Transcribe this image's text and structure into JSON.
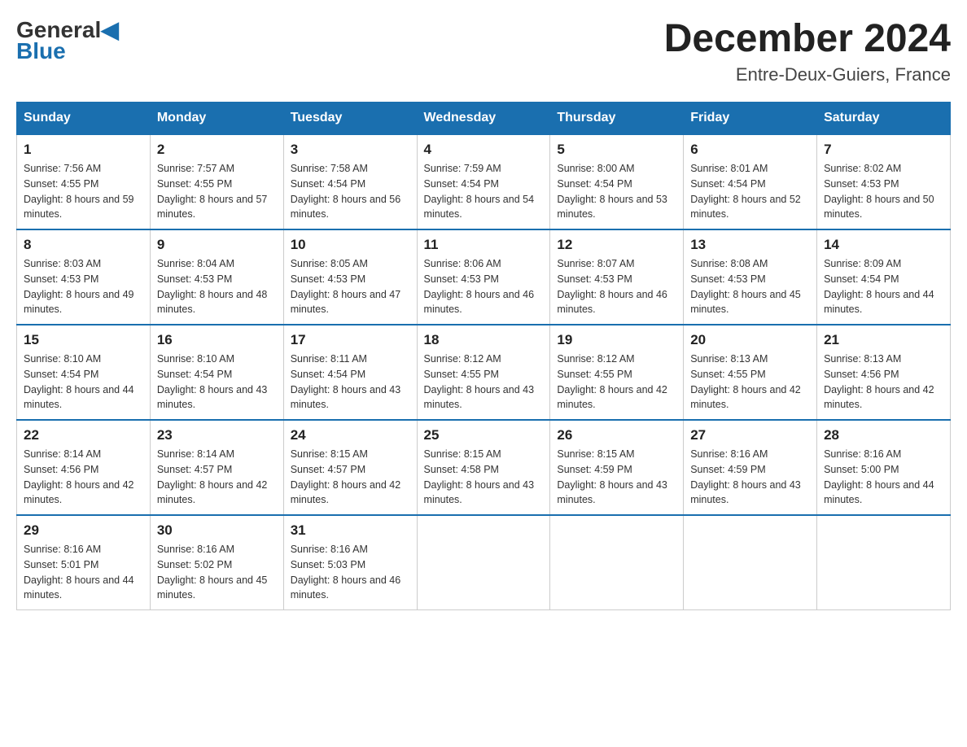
{
  "header": {
    "logo_general": "General",
    "logo_blue": "Blue",
    "month_year": "December 2024",
    "location": "Entre-Deux-Guiers, France"
  },
  "weekdays": [
    "Sunday",
    "Monday",
    "Tuesday",
    "Wednesday",
    "Thursday",
    "Friday",
    "Saturday"
  ],
  "weeks": [
    [
      {
        "day": "1",
        "sunrise": "7:56 AM",
        "sunset": "4:55 PM",
        "daylight": "8 hours and 59 minutes."
      },
      {
        "day": "2",
        "sunrise": "7:57 AM",
        "sunset": "4:55 PM",
        "daylight": "8 hours and 57 minutes."
      },
      {
        "day": "3",
        "sunrise": "7:58 AM",
        "sunset": "4:54 PM",
        "daylight": "8 hours and 56 minutes."
      },
      {
        "day": "4",
        "sunrise": "7:59 AM",
        "sunset": "4:54 PM",
        "daylight": "8 hours and 54 minutes."
      },
      {
        "day": "5",
        "sunrise": "8:00 AM",
        "sunset": "4:54 PM",
        "daylight": "8 hours and 53 minutes."
      },
      {
        "day": "6",
        "sunrise": "8:01 AM",
        "sunset": "4:54 PM",
        "daylight": "8 hours and 52 minutes."
      },
      {
        "day": "7",
        "sunrise": "8:02 AM",
        "sunset": "4:53 PM",
        "daylight": "8 hours and 50 minutes."
      }
    ],
    [
      {
        "day": "8",
        "sunrise": "8:03 AM",
        "sunset": "4:53 PM",
        "daylight": "8 hours and 49 minutes."
      },
      {
        "day": "9",
        "sunrise": "8:04 AM",
        "sunset": "4:53 PM",
        "daylight": "8 hours and 48 minutes."
      },
      {
        "day": "10",
        "sunrise": "8:05 AM",
        "sunset": "4:53 PM",
        "daylight": "8 hours and 47 minutes."
      },
      {
        "day": "11",
        "sunrise": "8:06 AM",
        "sunset": "4:53 PM",
        "daylight": "8 hours and 46 minutes."
      },
      {
        "day": "12",
        "sunrise": "8:07 AM",
        "sunset": "4:53 PM",
        "daylight": "8 hours and 46 minutes."
      },
      {
        "day": "13",
        "sunrise": "8:08 AM",
        "sunset": "4:53 PM",
        "daylight": "8 hours and 45 minutes."
      },
      {
        "day": "14",
        "sunrise": "8:09 AM",
        "sunset": "4:54 PM",
        "daylight": "8 hours and 44 minutes."
      }
    ],
    [
      {
        "day": "15",
        "sunrise": "8:10 AM",
        "sunset": "4:54 PM",
        "daylight": "8 hours and 44 minutes."
      },
      {
        "day": "16",
        "sunrise": "8:10 AM",
        "sunset": "4:54 PM",
        "daylight": "8 hours and 43 minutes."
      },
      {
        "day": "17",
        "sunrise": "8:11 AM",
        "sunset": "4:54 PM",
        "daylight": "8 hours and 43 minutes."
      },
      {
        "day": "18",
        "sunrise": "8:12 AM",
        "sunset": "4:55 PM",
        "daylight": "8 hours and 43 minutes."
      },
      {
        "day": "19",
        "sunrise": "8:12 AM",
        "sunset": "4:55 PM",
        "daylight": "8 hours and 42 minutes."
      },
      {
        "day": "20",
        "sunrise": "8:13 AM",
        "sunset": "4:55 PM",
        "daylight": "8 hours and 42 minutes."
      },
      {
        "day": "21",
        "sunrise": "8:13 AM",
        "sunset": "4:56 PM",
        "daylight": "8 hours and 42 minutes."
      }
    ],
    [
      {
        "day": "22",
        "sunrise": "8:14 AM",
        "sunset": "4:56 PM",
        "daylight": "8 hours and 42 minutes."
      },
      {
        "day": "23",
        "sunrise": "8:14 AM",
        "sunset": "4:57 PM",
        "daylight": "8 hours and 42 minutes."
      },
      {
        "day": "24",
        "sunrise": "8:15 AM",
        "sunset": "4:57 PM",
        "daylight": "8 hours and 42 minutes."
      },
      {
        "day": "25",
        "sunrise": "8:15 AM",
        "sunset": "4:58 PM",
        "daylight": "8 hours and 43 minutes."
      },
      {
        "day": "26",
        "sunrise": "8:15 AM",
        "sunset": "4:59 PM",
        "daylight": "8 hours and 43 minutes."
      },
      {
        "day": "27",
        "sunrise": "8:16 AM",
        "sunset": "4:59 PM",
        "daylight": "8 hours and 43 minutes."
      },
      {
        "day": "28",
        "sunrise": "8:16 AM",
        "sunset": "5:00 PM",
        "daylight": "8 hours and 44 minutes."
      }
    ],
    [
      {
        "day": "29",
        "sunrise": "8:16 AM",
        "sunset": "5:01 PM",
        "daylight": "8 hours and 44 minutes."
      },
      {
        "day": "30",
        "sunrise": "8:16 AM",
        "sunset": "5:02 PM",
        "daylight": "8 hours and 45 minutes."
      },
      {
        "day": "31",
        "sunrise": "8:16 AM",
        "sunset": "5:03 PM",
        "daylight": "8 hours and 46 minutes."
      },
      null,
      null,
      null,
      null
    ]
  ]
}
